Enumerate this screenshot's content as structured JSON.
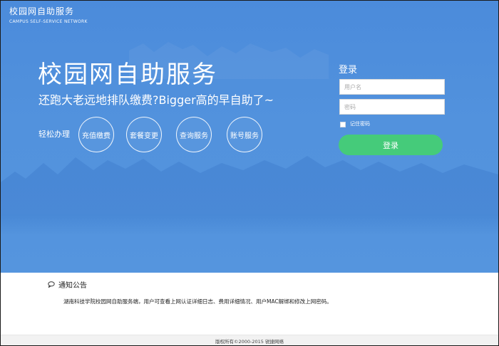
{
  "brand": {
    "name": "校园网自助服务",
    "en": "CAMPUS  SELF-SERVICE NETWORK"
  },
  "hero": {
    "title": "校园网自助服务",
    "subtitle": "还跑大老远地排队缴费?Bigger高的早自助了~",
    "quick_label": "轻松办理",
    "quick_actions": [
      "充值缴费",
      "套餐变更",
      "查询服务",
      "账号服务"
    ]
  },
  "login": {
    "title": "登录",
    "username_placeholder": "用户名",
    "password_placeholder": "密码",
    "remember_label": "记住密码",
    "submit_label": "登录"
  },
  "notice": {
    "title": "通知公告",
    "text": "湖南科技学院校园网自助服务端，用户可查看上网认证详细日志、费用详细情况、用户MAC解绑和修改上网密码。"
  },
  "footer": {
    "copyright": "版权所有©2000-2015 锐捷网络"
  },
  "colors": {
    "hero_blue": "#5292dd",
    "login_green": "#45cb7a"
  }
}
